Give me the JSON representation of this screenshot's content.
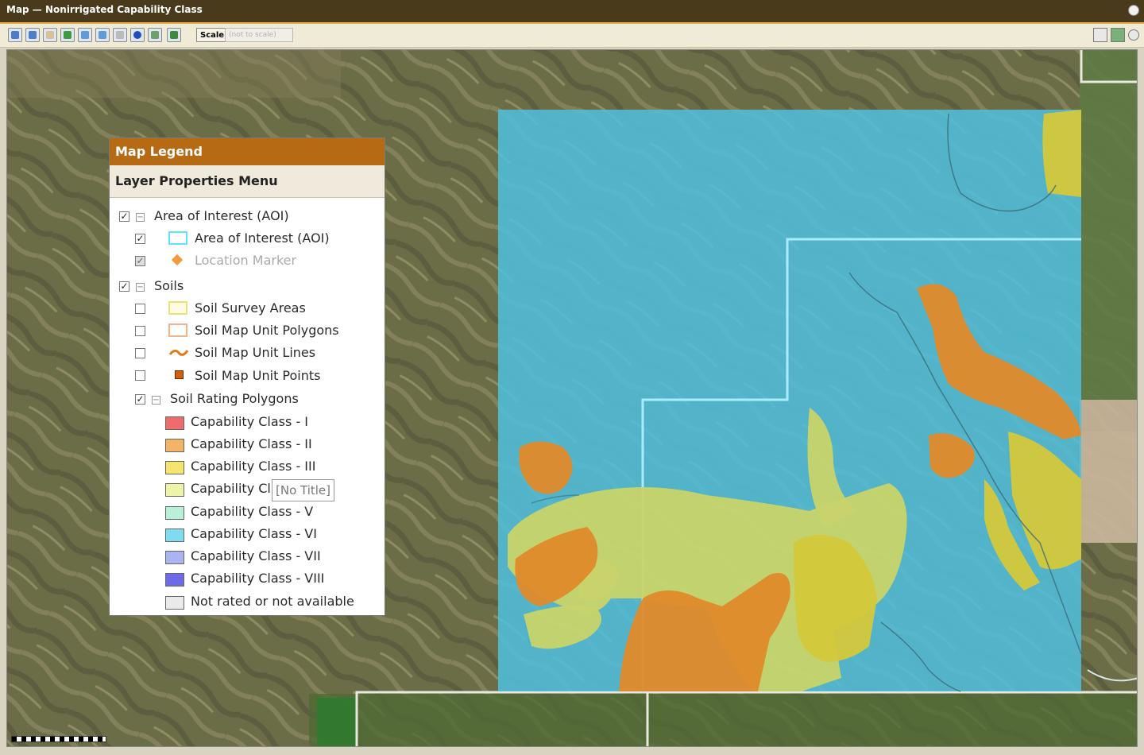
{
  "window": {
    "title": "Map — Nonirrigated Capability Class"
  },
  "toolbar": {
    "scale_label": "Scale",
    "scale_value": "(not to scale)",
    "icons": [
      "zoom-in-icon",
      "zoom-out-icon",
      "pan-icon",
      "full-extent-icon",
      "previous-extent-icon",
      "next-extent-icon",
      "measure-icon",
      "identify-icon",
      "print-icon",
      "export-icon"
    ]
  },
  "legend": {
    "title": "Map Legend",
    "subtitle": "Layer Properties Menu",
    "groups": [
      {
        "label": "Area of Interest (AOI)",
        "checked": true,
        "items": [
          {
            "label": "Area of Interest (AOI)",
            "checked": true,
            "symbol": "aoi-outline-icon",
            "color": "#5fe3ff"
          },
          {
            "label": "Location Marker",
            "checked": true,
            "symbol": "location-diamond-icon",
            "color": "#f39a3c",
            "disabled": true
          }
        ]
      },
      {
        "label": "Soils",
        "checked": true,
        "items": [
          {
            "label": "Soil Survey Areas",
            "checked": false,
            "symbol": "survey-area-swatch-icon",
            "color": "#f7ec9a"
          },
          {
            "label": "Soil Map Unit Polygons",
            "checked": false,
            "symbol": "polygon-swatch-icon",
            "color": "#f7c7a4"
          },
          {
            "label": "Soil Map Unit Lines",
            "checked": false,
            "symbol": "line-symbol-icon",
            "color": "#e07b1a"
          },
          {
            "label": "Soil Map Unit Points",
            "checked": false,
            "symbol": "point-symbol-icon",
            "color": "#d0600c"
          },
          {
            "label": "Soil Rating Polygons",
            "checked": true
          }
        ]
      }
    ],
    "classes": [
      {
        "label": "Capability Class - I",
        "color": "#f06b6b"
      },
      {
        "label": "Capability Class - II",
        "color": "#f4b468"
      },
      {
        "label": "Capability Class - III",
        "color": "#f5e56c"
      },
      {
        "label": "Capability Class - IV",
        "color": "#eff3a8"
      },
      {
        "label": "Capability Class - V",
        "color": "#b8f0d8"
      },
      {
        "label": "Capability Class - VI",
        "color": "#7fdcf0"
      },
      {
        "label": "Capability Class - VII",
        "color": "#aab4f0"
      },
      {
        "label": "Capability Class - VIII",
        "color": "#6b6bea"
      },
      {
        "label": "Not rated or not available",
        "color": "#eaeaea"
      }
    ],
    "tooltip": "[No Title]"
  },
  "colors": {
    "accent": "#b66a14",
    "aoi_fill": "#4fc1e0",
    "class_ii": "#e08a2a",
    "class_iv": "#c8d46a"
  }
}
